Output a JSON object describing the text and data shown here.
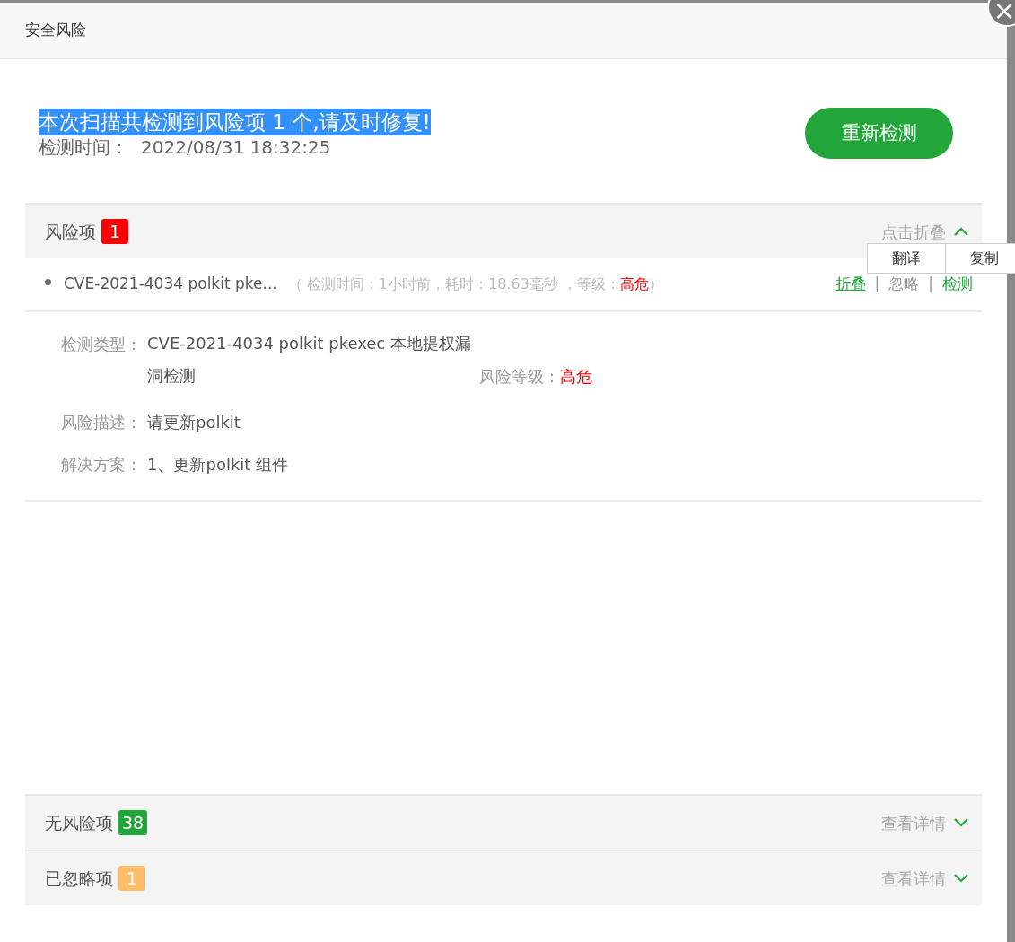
{
  "dialog": {
    "title": "安全风险",
    "close_icon": "×"
  },
  "summary": {
    "headline": "本次扫描共检测到风险项 1 个,请及时修复!",
    "highlighted": true,
    "time_label": "检测时间：",
    "time": "2022/08/31 18:32:25",
    "rescan_button": "重新检测"
  },
  "sections": [
    {
      "title": "风险项",
      "count": "1",
      "color": "#ff0000",
      "toggle": "点击折叠",
      "expanded": true,
      "items": [
        {
          "name": "CVE-2021-4034 polkit pke...",
          "meta": "（ 检测时间：1小时前，耗时：18.63毫秒 ，等级：",
          "level": "高危",
          "meta_end": "）",
          "separator": "|",
          "actions": [
            {
              "label": "折叠",
              "underlined": true
            },
            {
              "label": "忽略",
              "underlined": false
            },
            {
              "label": "检测",
              "underlined": false
            }
          ],
          "details": {
            "type_label": "检测类型：",
            "type": "CVE-2021-4034 polkit pkexec 本地提权漏洞检测",
            "risk_label": "风险等级：",
            "risk": "高危",
            "desc_label": "风险描述：",
            "desc": "请更新polkit",
            "fix_label": "解决方案：",
            "fix": "1、更新polkit 组件"
          }
        }
      ]
    },
    {
      "title": "无风险项",
      "count": "38",
      "color": "#22a63a",
      "toggle": "查看详情",
      "expanded": false
    },
    {
      "title": "已忽略项",
      "count": "1",
      "color": "#ffbd69",
      "toggle": "查看详情",
      "expanded": false
    }
  ],
  "context_menu": [
    "翻译",
    "复制"
  ]
}
